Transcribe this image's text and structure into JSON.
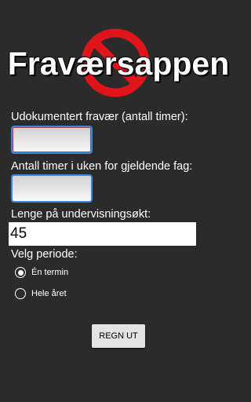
{
  "app": {
    "title": "Fraværsappen",
    "logo_icon": "no-entry-sign-icon"
  },
  "form": {
    "undocumented_label": "Udokumentert fravær (antall timer):",
    "undocumented_value": "",
    "hours_per_week_label": "Antall timer i uken for gjeldende fag:",
    "hours_per_week_value": "",
    "session_length_label": "Lenge på undervisningsøkt:",
    "session_length_value": "45",
    "period_label": "Velg periode:",
    "period_options": [
      {
        "label": "Én termin",
        "selected": true
      },
      {
        "label": "Hele året",
        "selected": false
      }
    ],
    "calculate_label": "REGN UT"
  },
  "colors": {
    "background": "#2b2b2b",
    "sign_red": "#e0141b",
    "input_border": "#3a87e0"
  }
}
